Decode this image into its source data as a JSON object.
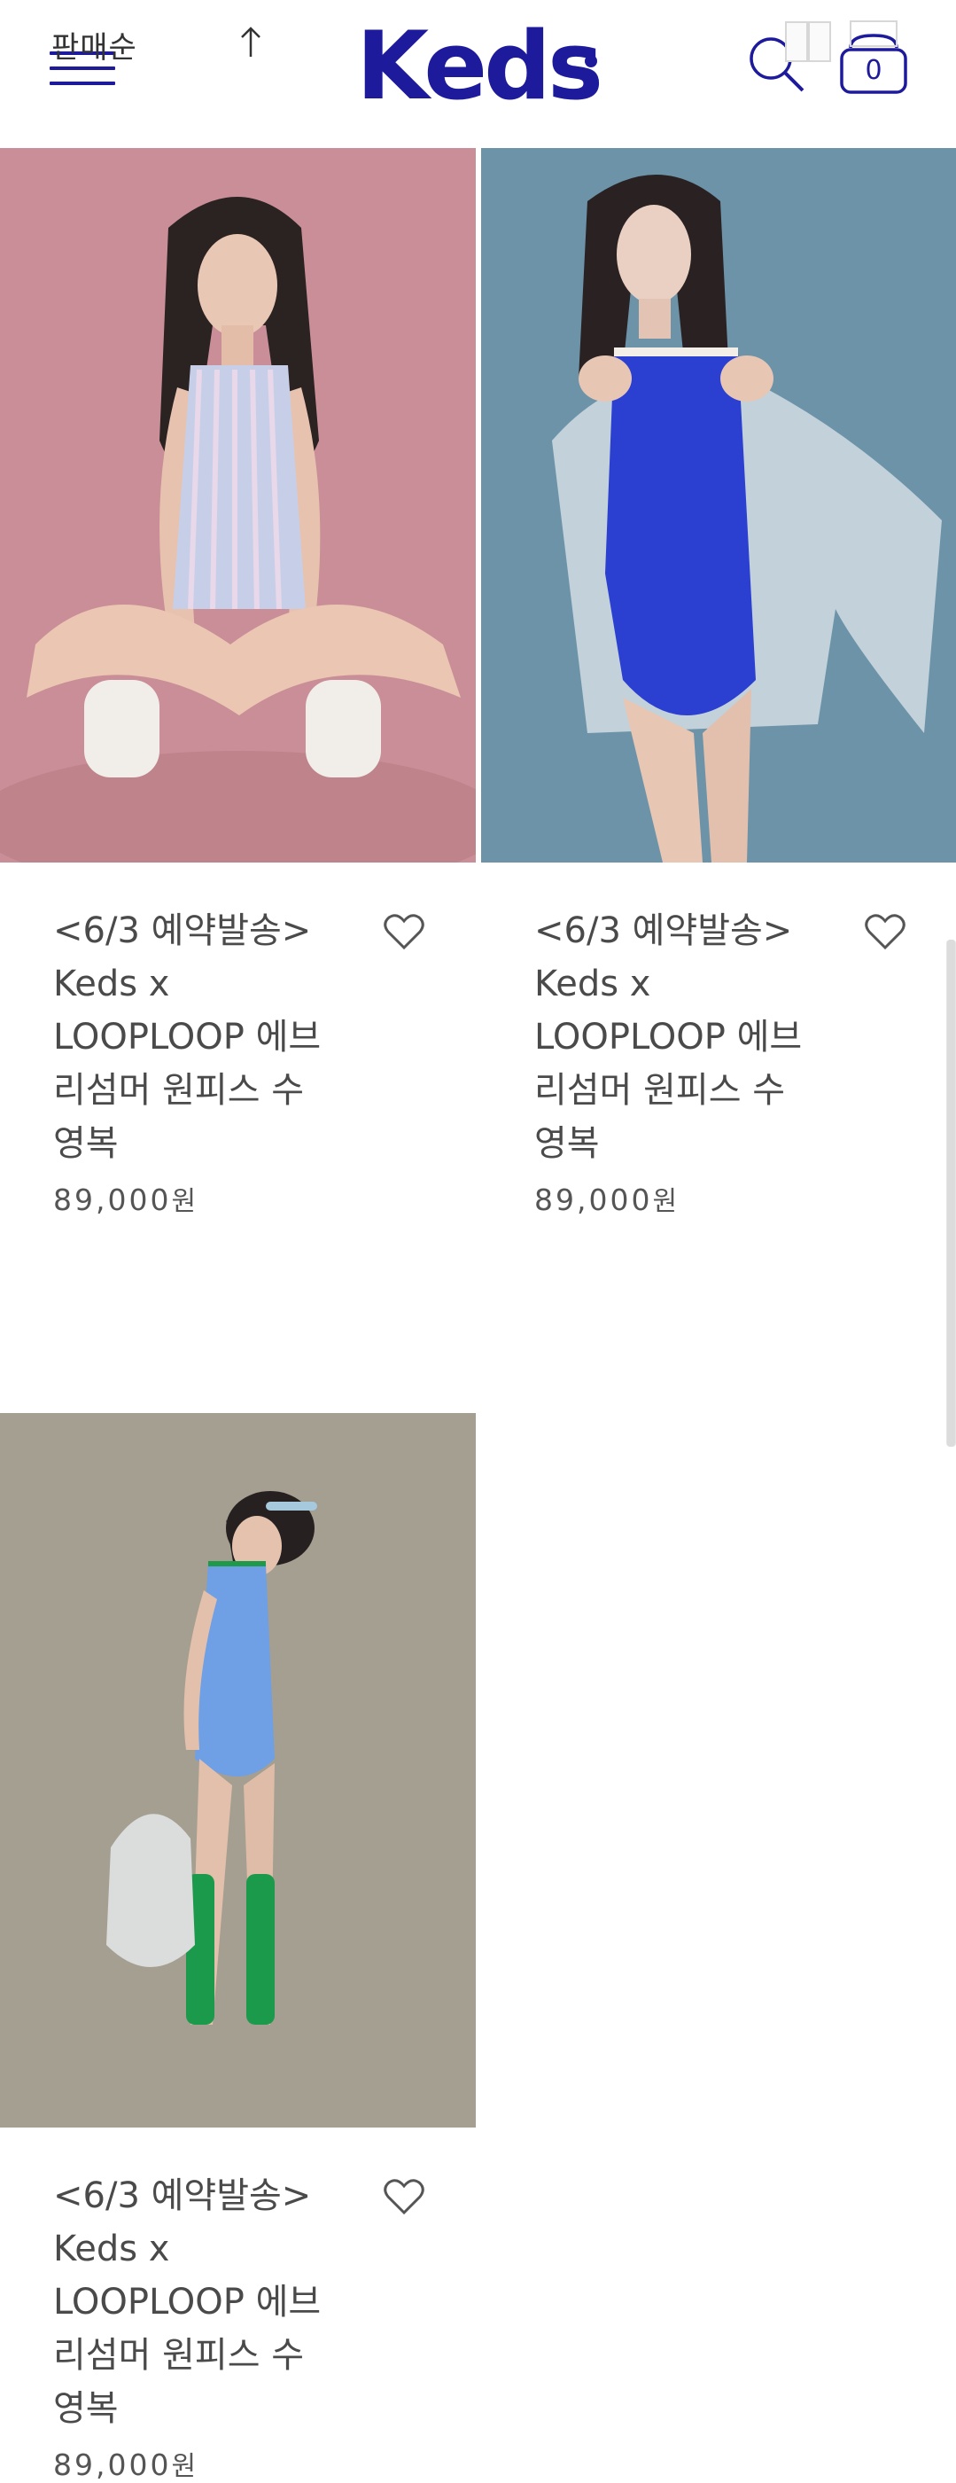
{
  "header": {
    "sort_label": "판매순",
    "logo_text": "Keds",
    "cart_count": "0"
  },
  "products": [
    {
      "name": "<6/3 예약발송>\nKeds x\nLOOPLOOP 에브\n리섬머 원피스 수\n영복",
      "price_number": "89,000",
      "currency": "원",
      "image_desc": "pastel striped swimsuit on pink background"
    },
    {
      "name": "<6/3 예약발송>\nKeds x\nLOOPLOOP 에브\n리섬머 원피스 수\n영복",
      "price_number": "89,000",
      "currency": "원",
      "image_desc": "royal blue swimsuit with white jacket on blue background"
    },
    {
      "name": "<6/3 예약발송>\nKeds x\nLOOPLOOP 에브\n리섬머 원피스 수\n영복",
      "price_number": "89,000",
      "currency": "원",
      "image_desc": "light blue swimsuit with green socks on grey background"
    }
  ],
  "colors": {
    "brand": "#1d1b9c",
    "text": "#4a4a4a",
    "pink_bg": "#c98e97",
    "blue_bg": "#6d93a8",
    "grey_bg": "#a59f92"
  }
}
